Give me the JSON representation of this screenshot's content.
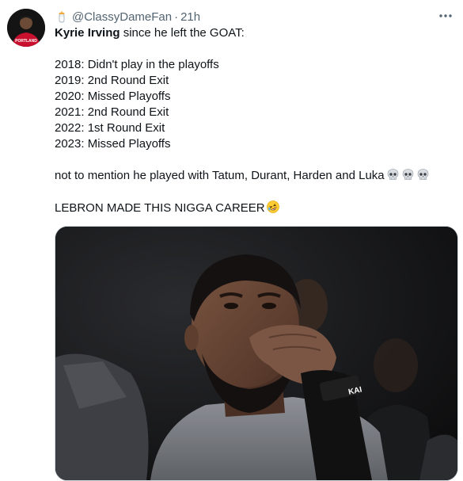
{
  "header": {
    "handle": "@ClassyDameFan",
    "separator": "·",
    "time": "21h"
  },
  "avatar": {
    "jersey_text": "PORTLAND"
  },
  "tweet": {
    "intro_bold": "Kyrie Irving",
    "intro_rest": " since he left the GOAT:",
    "seasons": [
      "2018: Didn't play in the playoffs",
      "2019: 2nd Round Exit",
      "2020: Missed Playoffs",
      "2021: 2nd Round Exit",
      "2022: 1st Round Exit",
      "2023: Missed Playoffs"
    ],
    "mention_line": "not to mention he played with Tatum, Durant, Harden and Luka",
    "closing_line": "LEBRON MADE THIS NIGGA CAREER"
  },
  "media": {
    "wristband_text": "KAI"
  },
  "icons": {
    "prefix_emoji": "baby-bottle-emoji-icon",
    "more": "more-options-icon",
    "skull": "skull-emoji-icon",
    "laugh": "rolling-on-floor-laughing-emoji-icon"
  },
  "colors": {
    "text": "#0f1419",
    "muted": "#536471",
    "border": "#cfd9de"
  }
}
